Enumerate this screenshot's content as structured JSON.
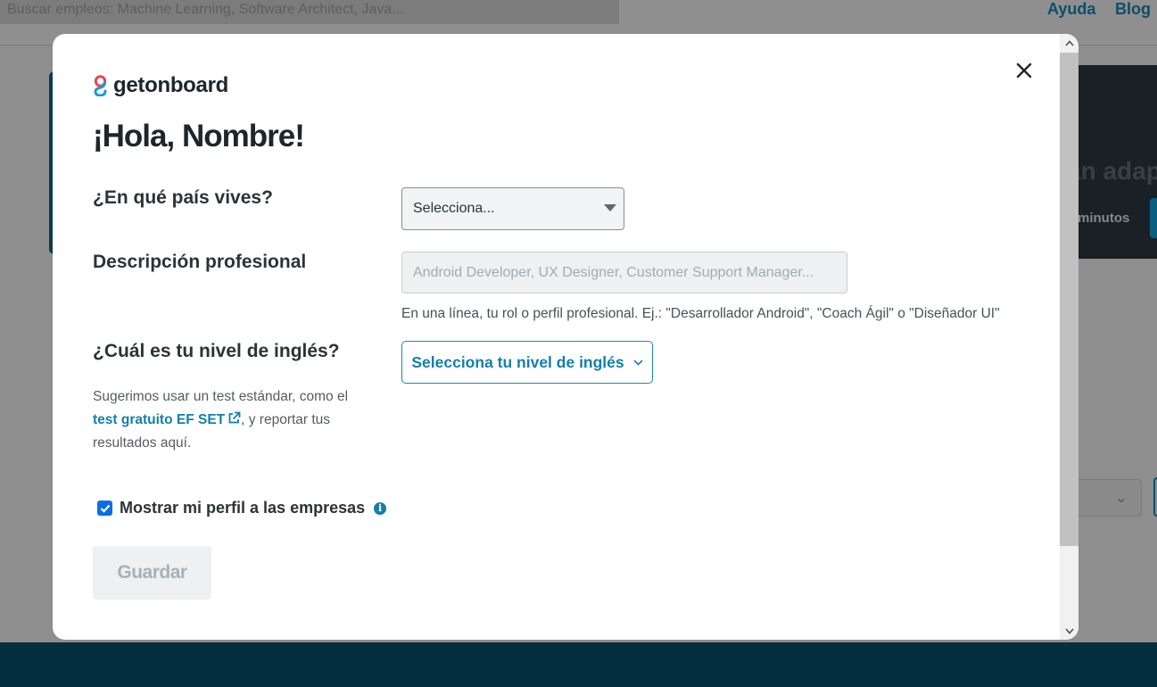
{
  "background": {
    "search_placeholder": "Buscar empleos: Machine Learning, Software Architect, Java...",
    "nav": {
      "help": "Ayuda",
      "blog": "Blog"
    },
    "hero_title_fragment": "an adap",
    "hero_sub_fragment": "minutos"
  },
  "modal": {
    "logo_text": "getonboard",
    "greeting": "¡Hola, Nombre!",
    "country": {
      "label": "¿En qué país vives?",
      "selected": "Selecciona..."
    },
    "description": {
      "label": "Descripción profesional",
      "placeholder": "Android Developer, UX Designer, Customer Support Manager...",
      "value": "",
      "hint": "En una línea, tu rol o perfil profesional. Ej.: \"Desarrollador Android\", \"Coach Ágil\" o \"Diseñador UI\""
    },
    "english": {
      "label": "¿Cuál es tu nivel de inglés?",
      "button": "Selecciona tu nivel de inglés",
      "suggest_before": "Sugerimos usar un test estándar, como el",
      "suggest_link": "test gratuito EF SET",
      "suggest_after": ", y reportar tus resultados aquí."
    },
    "show_profile": {
      "label": "Mostrar mi perfil a las empresas",
      "checked": true
    },
    "save_label": "Guardar"
  },
  "colors": {
    "accent": "#137fac",
    "checkbox": "#0b6ee8",
    "overlay": "#8e8e8e",
    "footer": "#052f3f"
  }
}
